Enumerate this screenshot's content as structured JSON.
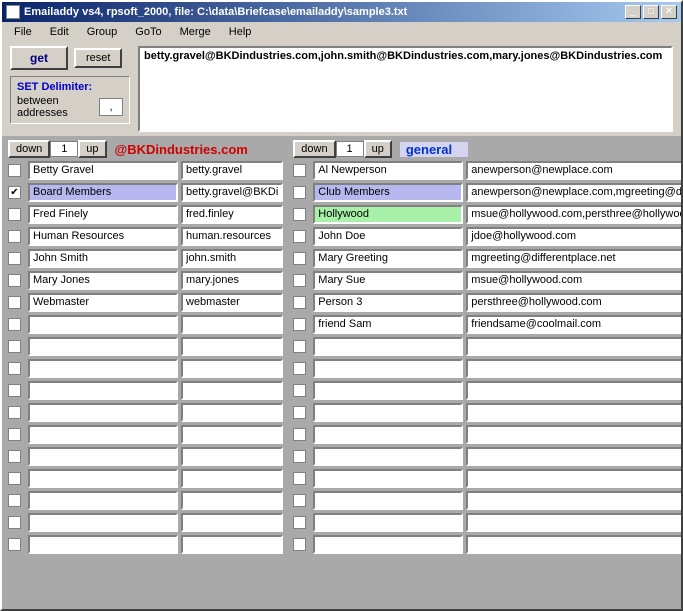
{
  "title": "Emailaddy vs4, rpsoft_2000, file: C:\\data\\Briefcase\\emailaddy\\sample3.txt",
  "menu": [
    "File",
    "Edit",
    "Group",
    "GoTo",
    "Merge",
    "Help"
  ],
  "btn_get": "get",
  "btn_reset": "reset",
  "delim": {
    "title": "SET Delimiter:",
    "label1": "between",
    "label2": "addresses",
    "value": ","
  },
  "output": "betty.gravel@BKDindustries.com,john.smith@BKDindustries.com,mary.jones@BKDindustries.com",
  "nav": {
    "down": "down",
    "up": "up",
    "page_left": "1",
    "page_right": "1"
  },
  "domain_label": "@BKDindustries.com",
  "gen_label": "general",
  "rows": 18,
  "left": [
    {
      "chk": false,
      "name": "Betty Gravel",
      "email": "betty.gravel"
    },
    {
      "chk": true,
      "name": "Board Members",
      "email": "betty.gravel@BKDi",
      "hl": "purple"
    },
    {
      "chk": false,
      "name": "Fred Finely",
      "email": "fred.finley"
    },
    {
      "chk": false,
      "name": "Human Resources",
      "email": "human.resources"
    },
    {
      "chk": false,
      "name": "John Smith",
      "email": "john.smith"
    },
    {
      "chk": false,
      "name": "Mary Jones",
      "email": "mary.jones"
    },
    {
      "chk": false,
      "name": "Webmaster",
      "email": "webmaster"
    }
  ],
  "right": [
    {
      "chk": false,
      "name": "Al Newperson",
      "email": "anewperson@newplace.com"
    },
    {
      "chk": false,
      "name": "Club Members",
      "email": "anewperson@newplace.com,mgreeting@dif",
      "hl": "purple"
    },
    {
      "chk": false,
      "name": "Hollywood",
      "email": "msue@hollywood.com,persthree@hollywood",
      "hl": "green"
    },
    {
      "chk": false,
      "name": "John Doe",
      "email": "jdoe@hollywood.com"
    },
    {
      "chk": false,
      "name": "Mary Greeting",
      "email": "mgreeting@differentplace.net"
    },
    {
      "chk": false,
      "name": "Mary Sue",
      "email": "msue@hollywood.com"
    },
    {
      "chk": false,
      "name": "Person 3",
      "email": "persthree@hollywood.com"
    },
    {
      "chk": false,
      "name": "friend Sam",
      "email": "friendsame@coolmail.com"
    }
  ]
}
